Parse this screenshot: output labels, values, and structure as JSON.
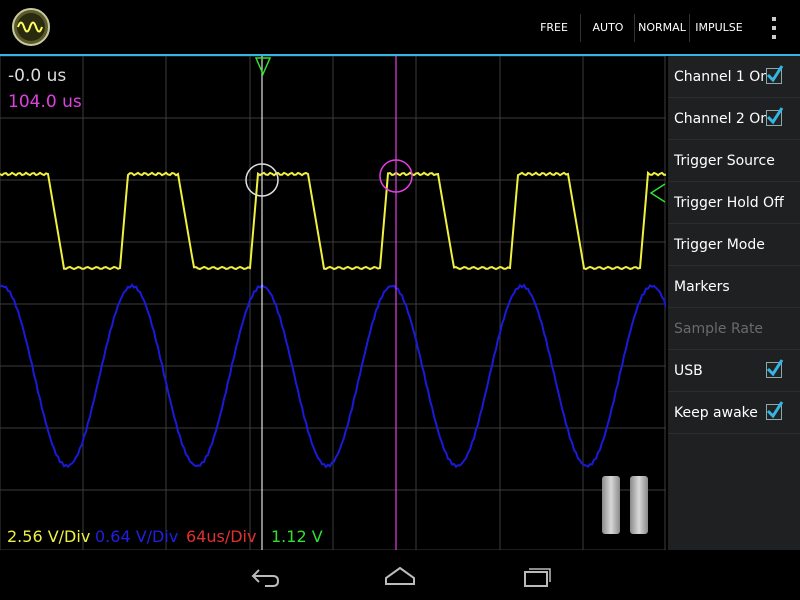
{
  "toolbar": {
    "buttons": [
      {
        "label": "FREE"
      },
      {
        "label": "AUTO"
      },
      {
        "label": "NORMAL"
      },
      {
        "label": "IMPULSE"
      }
    ]
  },
  "readouts": {
    "cursor1_time": "-0.0 us",
    "cursor2_time": "104.0 us"
  },
  "scales": {
    "ch1_scale": "2.56 V/Div",
    "ch2_scale": "0.64 V/Div",
    "time_scale": "64us/Div",
    "trigger_level": "1.12 V"
  },
  "menu": {
    "items": [
      {
        "label": "Channel 1 On",
        "checkbox": true,
        "checked": true,
        "enabled": true
      },
      {
        "label": "Channel 2 On",
        "checkbox": true,
        "checked": true,
        "enabled": true
      },
      {
        "label": "Trigger Source",
        "checkbox": false,
        "enabled": true
      },
      {
        "label": "Trigger Hold Off",
        "checkbox": false,
        "enabled": true
      },
      {
        "label": "Trigger Mode",
        "checkbox": false,
        "enabled": true
      },
      {
        "label": "Markers",
        "checkbox": false,
        "enabled": true
      },
      {
        "label": "Sample Rate",
        "checkbox": false,
        "enabled": false
      },
      {
        "label": "USB",
        "checkbox": true,
        "checked": true,
        "enabled": true
      },
      {
        "label": "Keep awake",
        "checkbox": true,
        "checked": true,
        "enabled": true
      }
    ]
  },
  "colors": {
    "accent": "#33b5e5",
    "channel1": "#f0f040",
    "channel2": "#1a1ad8",
    "cursor1": "#e0e0e0",
    "cursor2": "#e040e0",
    "time_scale": "#e03030",
    "trigger": "#30e030"
  },
  "icons": {
    "app": "oscilloscope-logo-icon",
    "overflow": "overflow-menu-icon",
    "pause": "pause-icon",
    "back": "back-icon",
    "home": "home-icon",
    "recents": "recents-icon"
  }
}
